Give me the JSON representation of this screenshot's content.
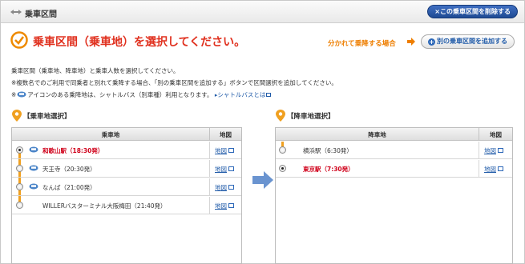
{
  "header": {
    "title": "乗車区間",
    "delete_button": "×この乗車区間を削除する"
  },
  "main": {
    "title": "乗車区間（乗車地）を選択してください。",
    "split_label": "分かれて乗降する場合",
    "add_button": "別の乗車区間を追加する",
    "desc_line1": "乗車区間（乗車地、降車地）と乗車人数を選択してください。",
    "desc_line2": "※複数名でのご利用で同乗者と別れて乗降する場合、「別の乗車区間を追加する」ボタンで区間選択を追加してください。",
    "desc_line3_pre": "※",
    "desc_line3_post": "アイコンのある乗降地は、シャトルバス（別車種）利用となります。",
    "shuttle_link": "シャトルバスとは"
  },
  "boarding": {
    "section_title": "【乗車地選択】",
    "col_stop": "乗車地",
    "col_map": "地図",
    "rows": [
      {
        "name": "和歌山駅（18:30発）",
        "selected": true,
        "bus": true,
        "map": "地図"
      },
      {
        "name": "天王寺（20:30発）",
        "selected": false,
        "bus": true,
        "map": "地図"
      },
      {
        "name": "なんば（21:00発）",
        "selected": false,
        "bus": true,
        "map": "地図"
      },
      {
        "name": "WILLERバスターミナル大阪梅田（21:40発）",
        "selected": false,
        "bus": false,
        "map": "地図"
      }
    ]
  },
  "alighting": {
    "section_title": "【降車地選択】",
    "col_stop": "降車地",
    "col_map": "地図",
    "rows": [
      {
        "name": "横浜駅（6:30発）",
        "selected": false,
        "map": "地図"
      },
      {
        "name": "東京駅（7:30発）",
        "selected": true,
        "map": "地図"
      }
    ]
  },
  "colors": {
    "accent_red": "#e0301e",
    "link_blue": "#1f5aa8",
    "orange": "#f0a020",
    "header_button": "#2a5aa8"
  }
}
